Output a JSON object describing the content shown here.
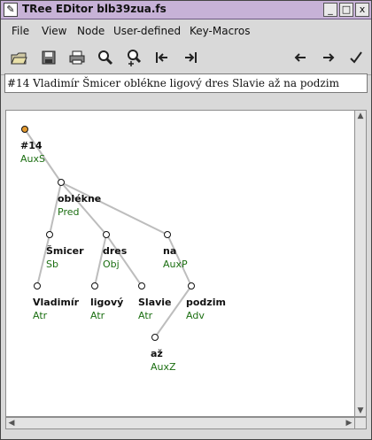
{
  "window": {
    "title": "TRee EDitor blb39zua.fs",
    "buttons": [
      "_",
      "□",
      "x"
    ]
  },
  "menu": [
    "File",
    "View",
    "Node",
    "User-defined",
    "Key-Macros"
  ],
  "toolbar": {
    "icons": [
      "open-folder-icon",
      "save-icon",
      "print-icon",
      "search-icon",
      "search-next-icon",
      "first-icon",
      "last-icon",
      "back-icon",
      "forward-icon",
      "check-icon"
    ]
  },
  "sentence": "#14 Vladimír Šmicer oblékne ligový dres Slavie až na podzim",
  "tree": {
    "root": {
      "label": "#14",
      "afun": "AuxS"
    },
    "nodes": [
      {
        "id": "obl",
        "label": "oblékne",
        "afun": "Pred"
      },
      {
        "id": "smi",
        "label": "Šmicer",
        "afun": "Sb"
      },
      {
        "id": "dres",
        "label": "dres",
        "afun": "Obj"
      },
      {
        "id": "na",
        "label": "na",
        "afun": "AuxP"
      },
      {
        "id": "vla",
        "label": "Vladimír",
        "afun": "Atr"
      },
      {
        "id": "lig",
        "label": "ligový",
        "afun": "Atr"
      },
      {
        "id": "sla",
        "label": "Slavie",
        "afun": "Atr"
      },
      {
        "id": "pod",
        "label": "podzim",
        "afun": "Adv"
      },
      {
        "id": "az",
        "label": "až",
        "afun": "AuxZ"
      }
    ]
  },
  "colors": {
    "title_bg": "#c7b2d7",
    "edge": "#bdbdbd",
    "afun": "#1b6e11",
    "root_node": "#e39a2f"
  }
}
